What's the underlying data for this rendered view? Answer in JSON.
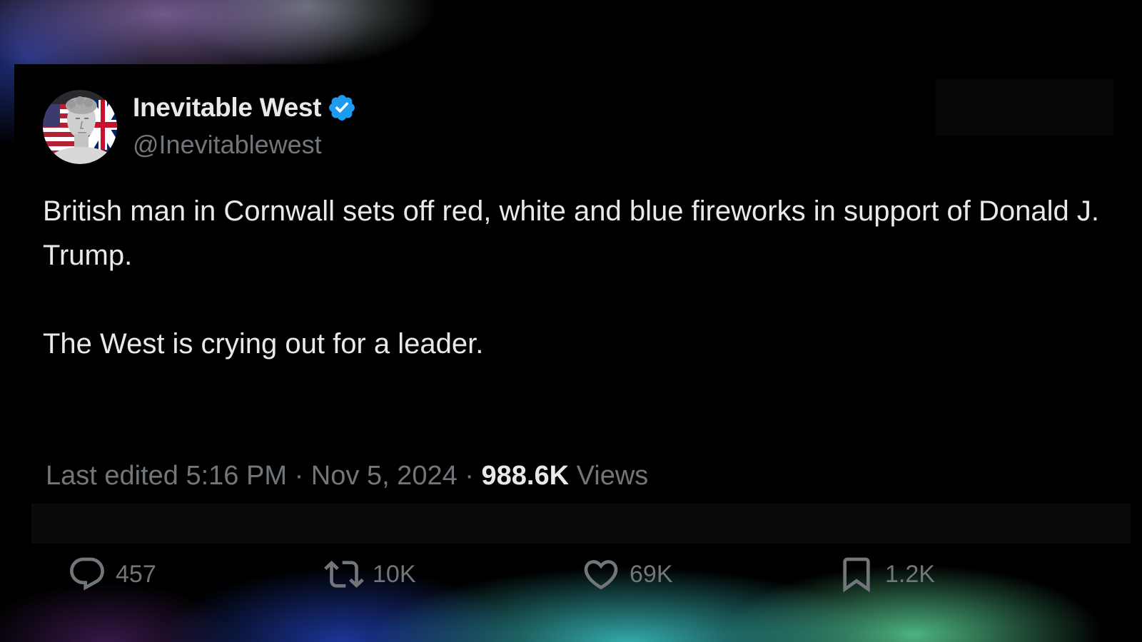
{
  "author": {
    "display_name": "Inevitable West",
    "handle": "@Inevitablewest",
    "verified": true,
    "avatar_icon": "statue-with-flags-avatar"
  },
  "tweet": {
    "paragraphs": [
      "British man in Cornwall sets off red, white and blue fireworks in support of Donald J. Trump.",
      "The West is crying out for a leader."
    ]
  },
  "meta": {
    "edited_label": "Last edited",
    "time": "5:16 PM",
    "separator": "·",
    "date": "Nov 5, 2024",
    "views_count": "988.6K",
    "views_label": "Views"
  },
  "actions": {
    "reply": {
      "icon": "reply-icon",
      "count": "457"
    },
    "repost": {
      "icon": "repost-icon",
      "count": "10K"
    },
    "like": {
      "icon": "heart-icon",
      "count": "69K"
    },
    "bookmark": {
      "icon": "bookmark-icon",
      "count": "1.2K"
    }
  },
  "colors": {
    "background": "#000000",
    "primary_text": "#e7e9ea",
    "secondary_text": "#71767b",
    "verified_blue": "#1d9bf0"
  }
}
